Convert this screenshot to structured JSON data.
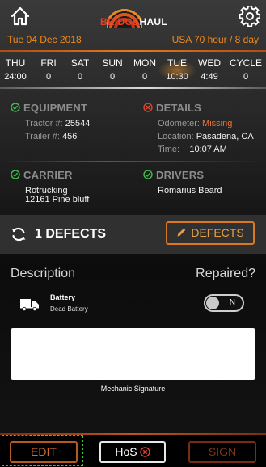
{
  "logo": {
    "text_a": "BRIDGE",
    "text_b": "HAUL"
  },
  "header": {
    "date": "Tue 04 Dec 2018",
    "rule": "USA 70 hour / 8 day"
  },
  "week": [
    {
      "day": "THU",
      "value": "24:00",
      "active": false
    },
    {
      "day": "FRI",
      "value": "0",
      "active": false
    },
    {
      "day": "SAT",
      "value": "0",
      "active": false
    },
    {
      "day": "SUN",
      "value": "0",
      "active": false
    },
    {
      "day": "MON",
      "value": "0",
      "active": false
    },
    {
      "day": "TUE",
      "value": "10:30",
      "active": true
    },
    {
      "day": "WED",
      "value": "4:49",
      "active": false
    },
    {
      "day": "CYCLE",
      "value": "0",
      "active": false
    }
  ],
  "equipment": {
    "title": "EQUIPMENT",
    "tractor_label": "Tractor #:",
    "tractor_value": "25544",
    "trailer_label": "Trailer #:",
    "trailer_value": "456"
  },
  "details": {
    "title": "DETAILS",
    "odometer_label": "Odometer:",
    "odometer_value": "Missing",
    "location_label": "Location:",
    "location_value": "Pasadena, CA",
    "time_label": "Time:",
    "time_value": "10:07 AM"
  },
  "carrier": {
    "title": "CARRIER",
    "name": "Rotrucking",
    "address": "12161 Pine bluff"
  },
  "drivers": {
    "title": "DRIVERS",
    "name": "Romarius Beard"
  },
  "defects": {
    "count_label": "1 DEFECTS",
    "button_label": "DEFECTS"
  },
  "description": {
    "header": "Description",
    "repaired_header": "Repaired?",
    "item_name": "Battery",
    "item_desc": "Dead Battery",
    "toggle_label": "N"
  },
  "signature": {
    "label": "Mechanic Signature"
  },
  "bottom": {
    "edit": "EDIT",
    "hos": "HoS",
    "sign": "SIGN"
  },
  "colors": {
    "accent": "#e8781e",
    "ok": "#3cbf4a",
    "warn": "#e0452e",
    "muted": "#8c8c8c"
  }
}
